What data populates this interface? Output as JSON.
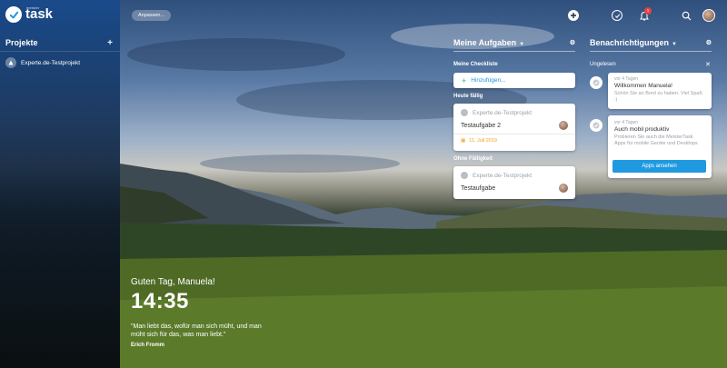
{
  "app": {
    "logo_small": "meister",
    "logo_main": "task"
  },
  "sidebar": {
    "heading": "Projekte",
    "projects": [
      {
        "label": "Experte.de-Testprojekt"
      }
    ]
  },
  "topbar": {
    "customize_label": "Anpassen...",
    "notification_count": "1"
  },
  "tasks_column": {
    "heading": "Meine Aufgaben",
    "checklist_label": "Meine Checkliste",
    "add_label": "Hinzufügen...",
    "due_today_label": "Heute fällig",
    "no_due_label": "Ohne Fälligkeit",
    "tasks": [
      {
        "project": "Experte.de-Testprojekt",
        "title": "Testaufgabe 2",
        "date": "11. Juli 2019"
      },
      {
        "project": "Experte.de-Testprojekt",
        "title": "Testaufgabe"
      }
    ]
  },
  "notifications_column": {
    "heading": "Benachrichtigungen",
    "unread_label": "Ungelesen",
    "items": [
      {
        "when": "vor 4 Tagen",
        "title": "Willkommen Manuela!",
        "body": "Schön Sie an Bord zu haben. Viel Spaß :)"
      },
      {
        "when": "vor 4 Tagen",
        "title": "Auch mobil produktiv",
        "body": "Probieren Sie auch die MeisterTask Apps für mobile Geräte und Desktops",
        "button": "Apps ansehen"
      }
    ]
  },
  "greeting": {
    "text": "Guten Tag, Manuela!",
    "time": "14:35",
    "quote": "\"Man liebt das, wofür man sich müht, und man müht sich für das, was man liebt.\"",
    "author": "Erich Fromm"
  },
  "colors": {
    "accent": "#1f9ae0",
    "add_green": "#21c07a",
    "date_orange": "#f0a020",
    "badge_red": "#e84040"
  }
}
